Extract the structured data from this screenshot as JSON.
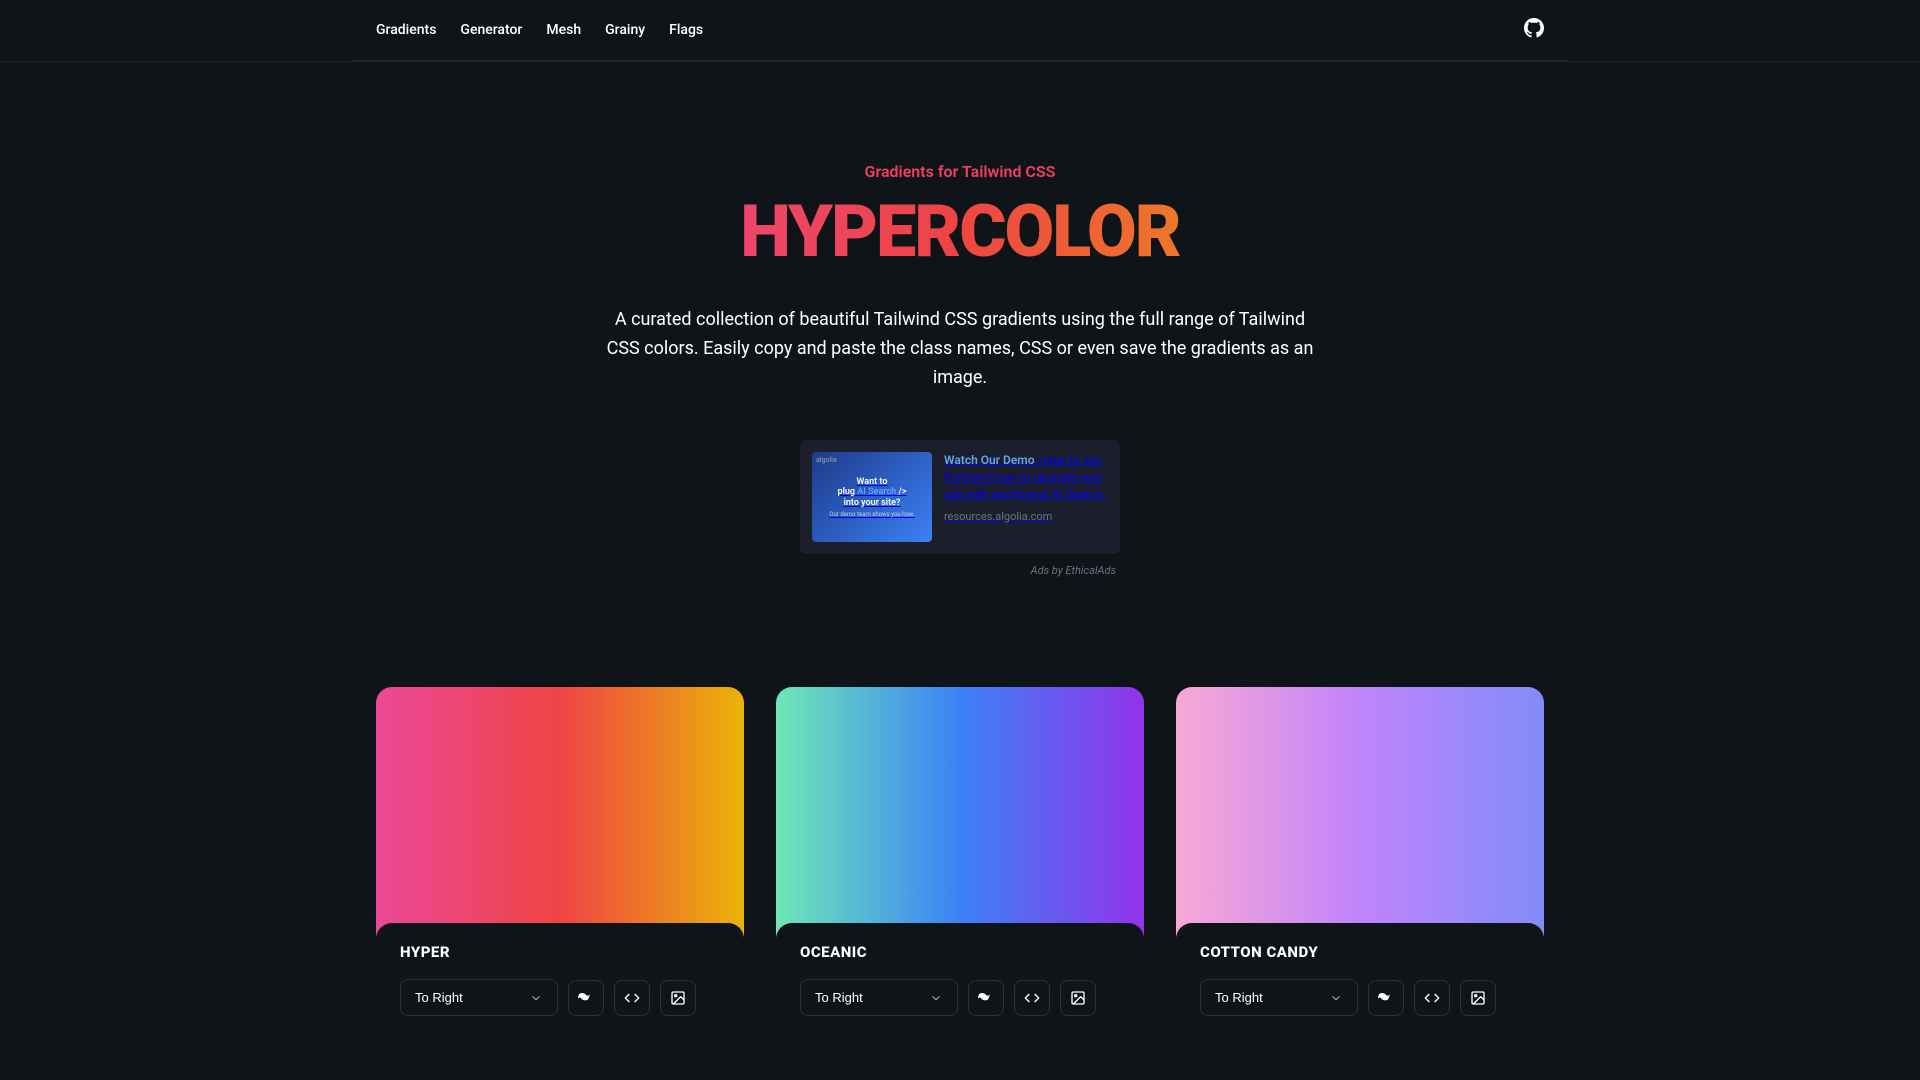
{
  "nav": {
    "links": [
      "Gradients",
      "Generator",
      "Mesh",
      "Grainy",
      "Flags"
    ]
  },
  "hero": {
    "subtitle": "Gradients for Tailwind CSS",
    "title": "HYPERCOLOR",
    "description": "A curated collection of beautiful Tailwind CSS gradients using the full range of Tailwind CSS colors. Easily copy and paste the class names, CSS or even save the gradients as an image."
  },
  "ad": {
    "image_logo": "algolia",
    "image_line1": "Want to",
    "image_line2_prefix": "plug",
    "image_line2_highlight": "AI Search",
    "image_line3": "into your site?",
    "image_sub": "Our demo team shows you how.",
    "link_text": "Watch Our Demo",
    "body": " video to see firsthand how to upgrade your site with end-to-end AI Search.",
    "source": "resources.algolia.com",
    "label": "Ads by EthicalAds"
  },
  "cards": [
    {
      "title": "HYPER",
      "direction": "To Right"
    },
    {
      "title": "OCEANIC",
      "direction": "To Right"
    },
    {
      "title": "COTTON CANDY",
      "direction": "To Right"
    }
  ]
}
